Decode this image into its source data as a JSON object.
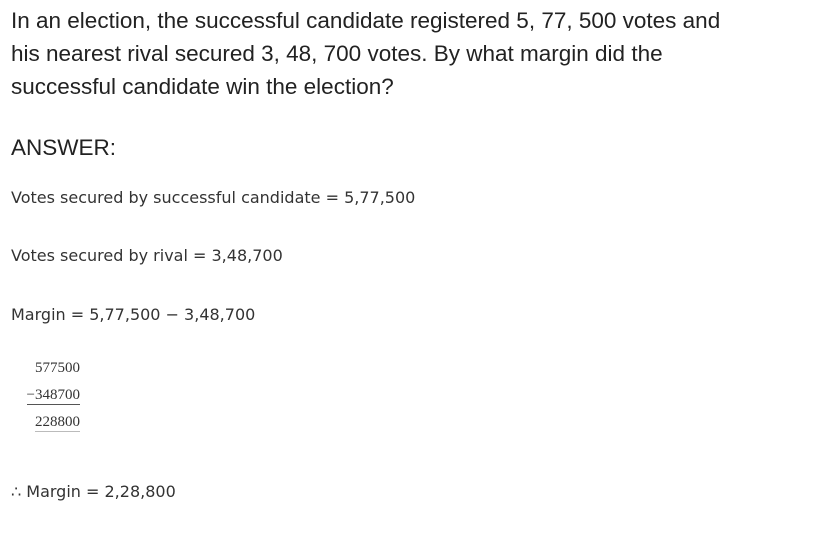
{
  "question": {
    "line1": "In an election, the successful candidate registered 5, 77, 500 votes and",
    "line2": "his nearest rival secured 3, 48, 700 votes. By what margin did the",
    "line3": "successful candidate win the election?"
  },
  "answer_heading": "ANSWER:",
  "steps": [
    "Votes secured by successful candidate = 5,77,500",
    "Votes secured by rival = 3,48,700",
    "Margin = 5,77,500 − 3,48,700",
    "∴ Margin = 2,28,800"
  ],
  "subtraction": {
    "minuend": "577500",
    "subtrahend": "−348700",
    "difference": "228800"
  }
}
